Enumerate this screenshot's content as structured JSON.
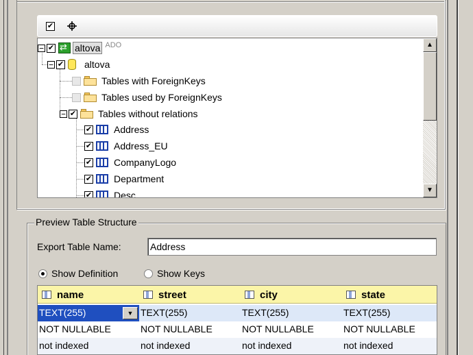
{
  "tree": {
    "connection": {
      "label": "altova",
      "badge": "ADO"
    },
    "database": {
      "label": "altova"
    },
    "folders": [
      {
        "label": "Tables with ForeignKeys",
        "checked": false
      },
      {
        "label": "Tables used by ForeignKeys",
        "checked": false
      },
      {
        "label": "Tables without relations",
        "checked": true
      }
    ],
    "tables": [
      "Address",
      "Address_EU",
      "CompanyLogo",
      "Department",
      "Desc"
    ]
  },
  "toolbar": {
    "check_glyph": "✔",
    "target_icon": "crosshair-icon"
  },
  "preview": {
    "legend": "Preview Table Structure",
    "export_label": "Export Table Name:",
    "export_value": "Address",
    "radio_definition": "Show Definition",
    "radio_keys": "Show Keys",
    "selected_radio": "definition"
  },
  "grid": {
    "columns": [
      "name",
      "street",
      "city",
      "state"
    ],
    "rows": [
      [
        "TEXT(255)",
        "TEXT(255)",
        "TEXT(255)",
        "TEXT(255)"
      ],
      [
        "NOT NULLABLE",
        "NOT NULLABLE",
        "NOT NULLABLE",
        "NOT NULLABLE"
      ],
      [
        "not indexed",
        "not indexed",
        "not indexed",
        "not indexed"
      ]
    ]
  },
  "colors": {
    "header_bg": "#fbf5a8",
    "selection": "#1f4fbf",
    "table_icon": "#1a3ea8"
  }
}
